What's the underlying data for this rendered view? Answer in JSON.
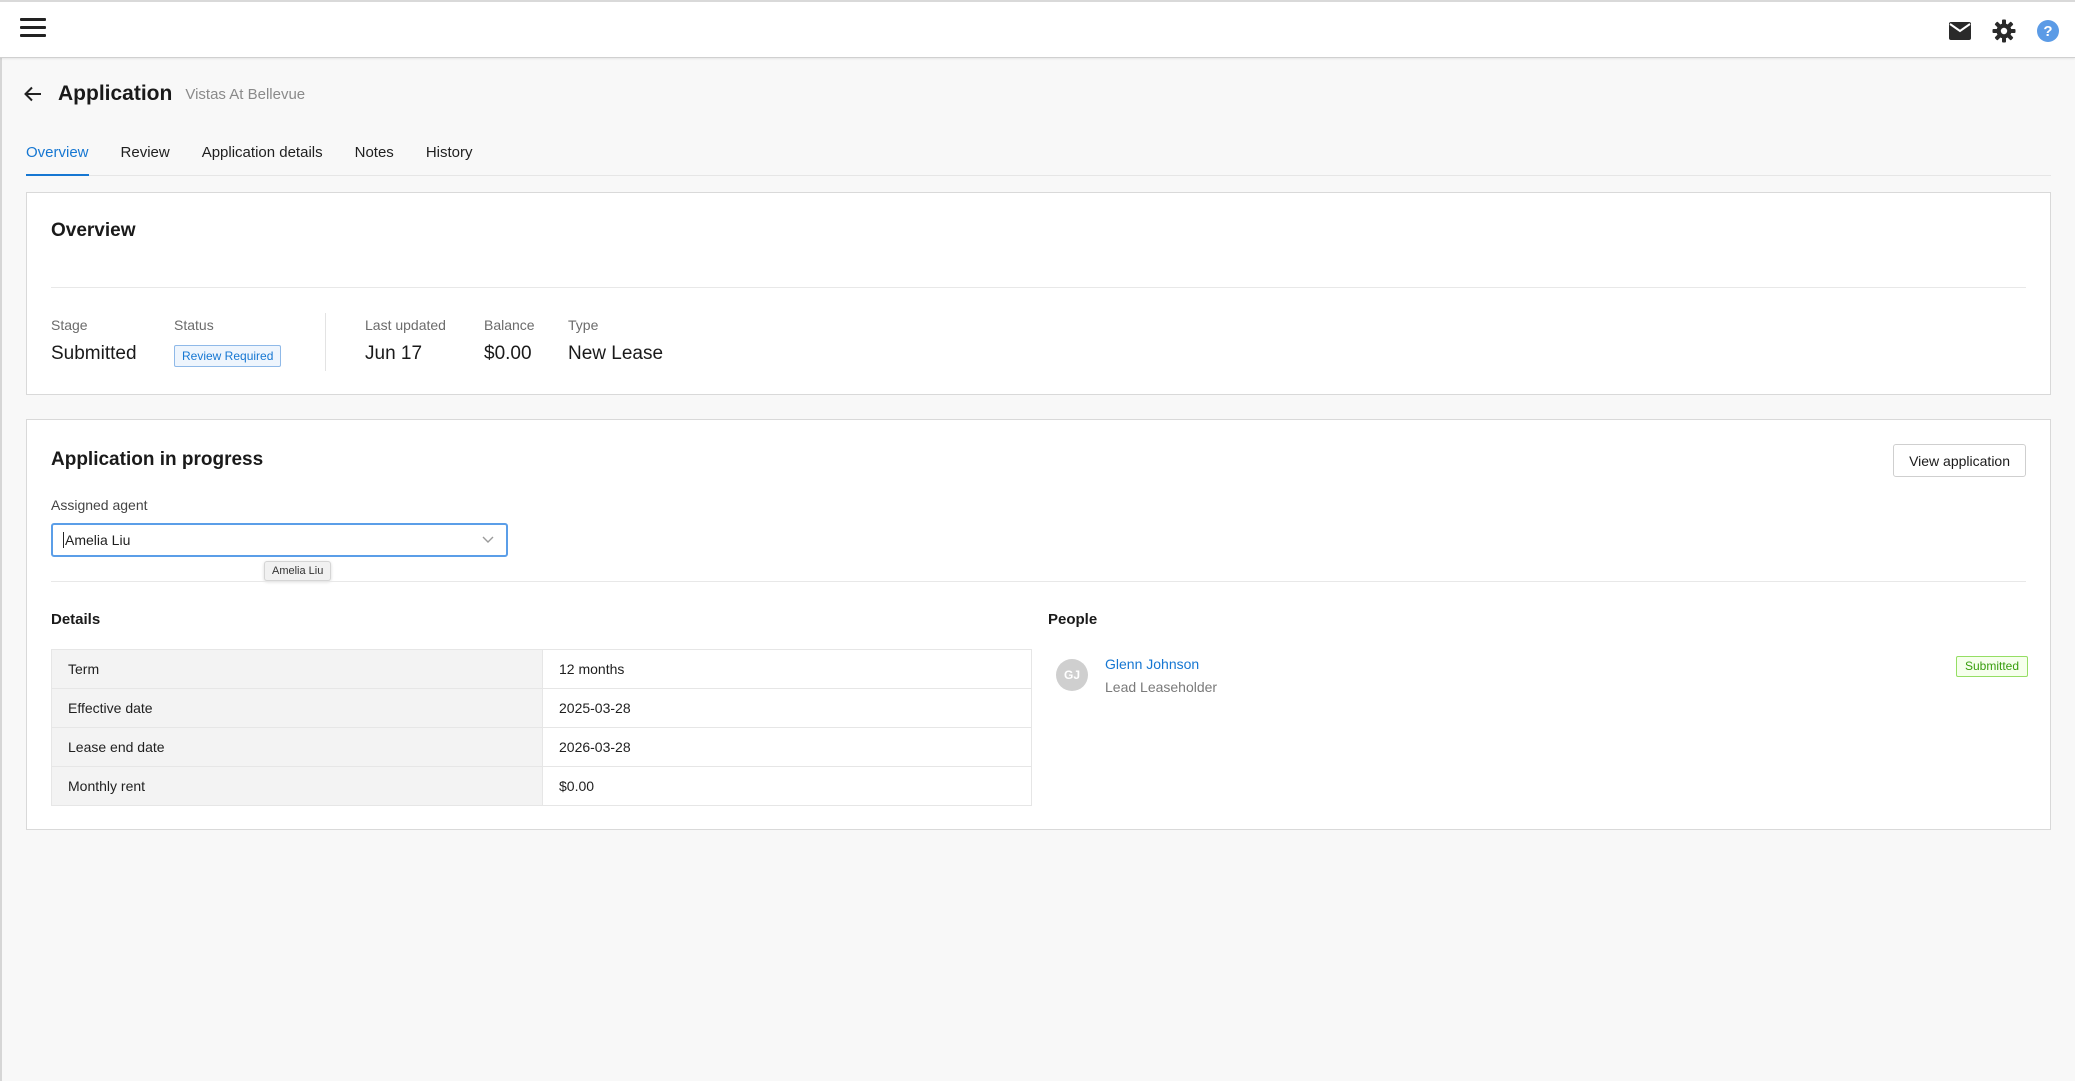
{
  "topbar": {
    "menu_icon": "hamburger-menu-icon",
    "icons": [
      "mail-icon",
      "gear-icon",
      "help-icon"
    ],
    "help_color": "#4a90e2"
  },
  "header": {
    "title": "Application",
    "subtitle": "Vistas At Bellevue"
  },
  "tabs": [
    {
      "label": "Overview",
      "active": true
    },
    {
      "label": "Review",
      "active": false
    },
    {
      "label": "Application details",
      "active": false
    },
    {
      "label": "Notes",
      "active": false
    },
    {
      "label": "History",
      "active": false
    }
  ],
  "overview": {
    "title": "Overview",
    "stage_label": "Stage",
    "stage_value": "Submitted",
    "status_label": "Status",
    "status_value": "Review Required",
    "last_updated_label": "Last updated",
    "last_updated_value": "Jun 17",
    "balance_label": "Balance",
    "balance_value": "$0.00",
    "type_label": "Type",
    "type_value": "New Lease"
  },
  "progress": {
    "title": "Application in progress",
    "view_button": "View application",
    "assigned_agent_label": "Assigned agent",
    "assigned_agent_value": "Amelia Liu",
    "tooltip": "Amelia Liu",
    "details_title": "Details",
    "details": [
      {
        "key": "Term",
        "value": "12 months"
      },
      {
        "key": "Effective date",
        "value": "2025-03-28"
      },
      {
        "key": "Lease end date",
        "value": "2026-03-28"
      },
      {
        "key": "Monthly rent",
        "value": "$0.00"
      }
    ],
    "people_title": "People",
    "people": [
      {
        "initials": "GJ",
        "name": "Glenn Johnson",
        "role": "Lead Leaseholder",
        "status": "Submitted"
      }
    ]
  },
  "colors": {
    "accent": "#1677d2",
    "success": "#389e0d",
    "background": "#f8f8f8"
  }
}
